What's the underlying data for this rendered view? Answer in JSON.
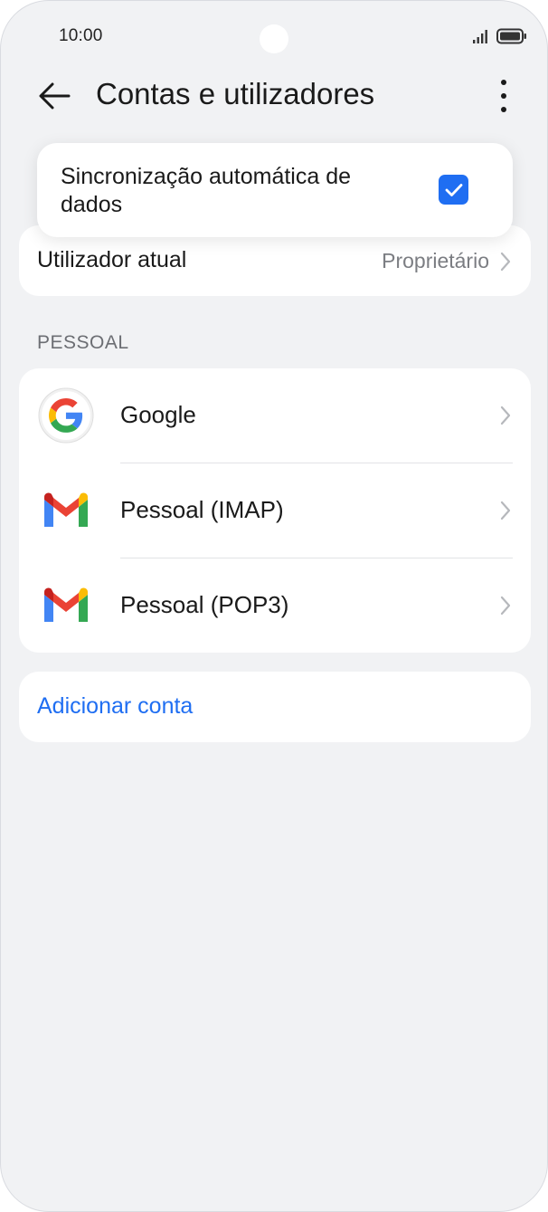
{
  "status_bar": {
    "time": "10:00",
    "icons": [
      "signal-icon",
      "battery-icon"
    ]
  },
  "header": {
    "title": "Contas e utilizadores",
    "back_icon": "arrow-left-icon",
    "more_icon": "more-vertical-icon"
  },
  "popup": {
    "text": "Sincronização automática de dados",
    "checked": true
  },
  "current_user": {
    "label": "Utilizador atual",
    "value": "Proprietário"
  },
  "section": {
    "label": "PESSOAL"
  },
  "accounts": [
    {
      "label": "Google",
      "icon": "google-icon"
    },
    {
      "label": "Pessoal (IMAP)",
      "icon": "gmail-icon"
    },
    {
      "label": "Pessoal (POP3)",
      "icon": "gmail-icon"
    }
  ],
  "add_account": {
    "label": "Adicionar conta"
  },
  "colors": {
    "accent": "#1f6ef2",
    "background": "#f1f2f4",
    "card": "#ffffff",
    "secondary_text": "#7b7d82"
  }
}
